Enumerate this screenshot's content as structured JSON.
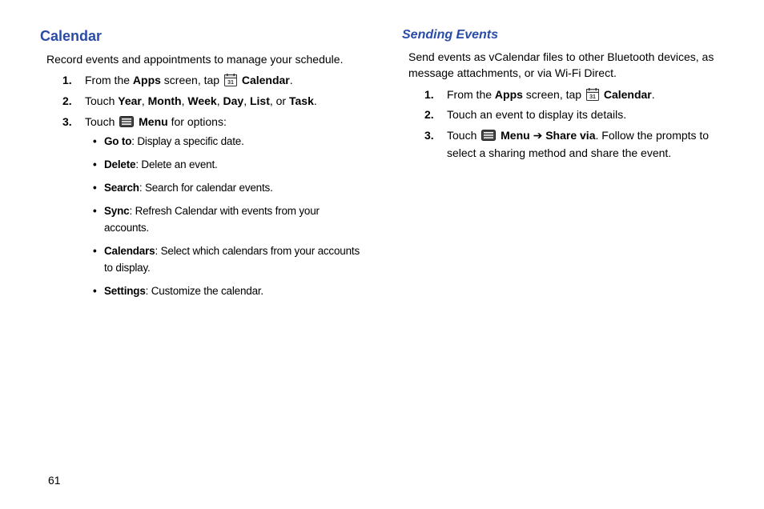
{
  "pageNumber": "61",
  "left": {
    "heading": "Calendar",
    "intro": "Record events and appointments to manage your schedule.",
    "steps": [
      {
        "num": "1.",
        "pre": "From the ",
        "b1": "Apps",
        "mid": " screen, tap ",
        "icon": "calendar",
        "b2": "Calendar",
        "post": "."
      },
      {
        "num": "2.",
        "pre": "Touch ",
        "parts": [
          "Year",
          "Month",
          "Week",
          "Day",
          "List",
          "Task"
        ],
        "post": "."
      },
      {
        "num": "3.",
        "pre": "Touch ",
        "icon": "menu",
        "b1": "Menu",
        "post": " for options:"
      }
    ],
    "bullets": [
      {
        "b": "Go to",
        "rest": ": Display a specific date."
      },
      {
        "b": "Delete",
        "rest": ": Delete an event."
      },
      {
        "b": "Search",
        "rest": ": Search for calendar events."
      },
      {
        "b": "Sync",
        "rest": ": Refresh Calendar with events from your accounts."
      },
      {
        "b": "Calendars",
        "rest": ": Select which calendars from your accounts to display."
      },
      {
        "b": "Settings",
        "rest": ": Customize the calendar."
      }
    ]
  },
  "right": {
    "heading": "Sending Events",
    "intro": "Send events as vCalendar files to other Bluetooth devices, as message attachments, or via Wi-Fi Direct.",
    "steps": [
      {
        "num": "1.",
        "pre": "From the ",
        "b1": "Apps",
        "mid": " screen, tap ",
        "icon": "calendar",
        "b2": "Calendar",
        "post": "."
      },
      {
        "num": "2.",
        "text": "Touch an event to display its details."
      },
      {
        "num": "3.",
        "pre": "Touch ",
        "icon": "menu",
        "b1": "Menu",
        "arrow": " ➔ ",
        "b2": "Share via",
        "post": ". Follow the prompts to select a sharing method and share the event."
      }
    ]
  },
  "icons": {
    "calendar": "calendar-icon",
    "menu": "menu-icon"
  }
}
